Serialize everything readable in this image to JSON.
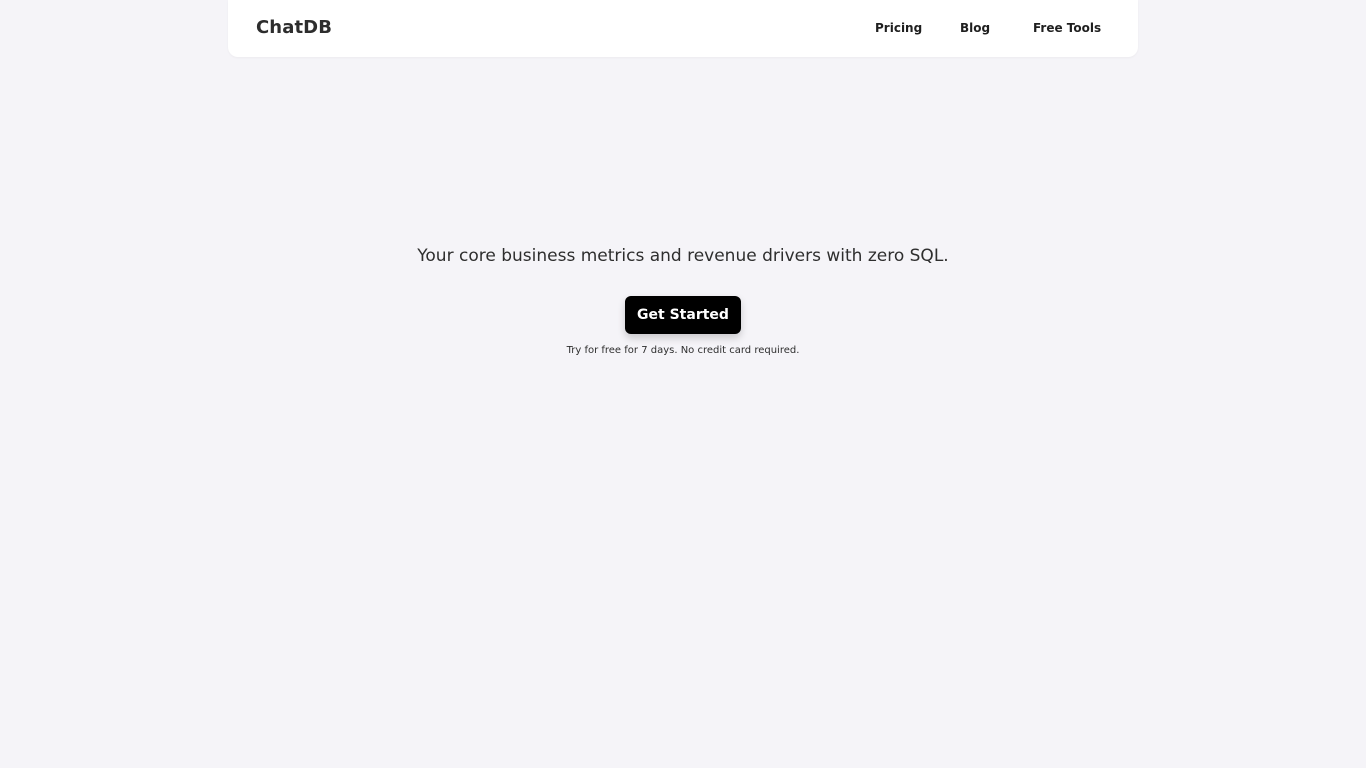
{
  "header": {
    "brand": "ChatDB",
    "nav": [
      {
        "label": "Pricing"
      },
      {
        "label": "Blog"
      },
      {
        "label": "Free Tools"
      }
    ]
  },
  "hero": {
    "tagline": "Your core business metrics and revenue drivers with zero SQL.",
    "cta_label": "Get Started",
    "note": "Try for free for 7 days. No credit card required."
  },
  "colors": {
    "background": "#f5f4f8",
    "navbar": "#ffffff",
    "cta_background": "#000000",
    "cta_text": "#ffffff"
  }
}
